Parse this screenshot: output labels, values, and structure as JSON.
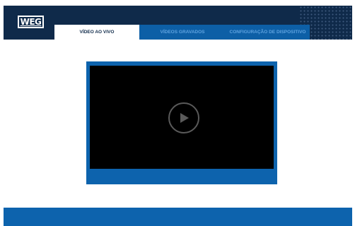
{
  "header": {
    "logo_text": "WEG",
    "tabs": [
      {
        "label": "VÍDEO AO VIVO",
        "active": true
      },
      {
        "label": "VÍDEOS GRAVADOS",
        "active": false
      },
      {
        "label": "CONFIGURAÇÃO DE DISPOSITIVO",
        "active": false
      }
    ]
  },
  "player": {
    "play_icon": "play-icon"
  },
  "colors": {
    "header_bg": "#0f2a4a",
    "accent_blue": "#0d63ad",
    "inactive_tab_text": "#5fa3e0",
    "video_bg": "#000000"
  }
}
